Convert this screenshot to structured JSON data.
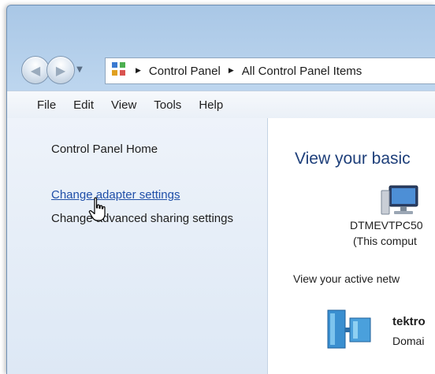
{
  "navigation": {
    "breadcrumb": [
      "Control Panel",
      "All Control Panel Items"
    ]
  },
  "menubar": {
    "items": [
      "File",
      "Edit",
      "View",
      "Tools",
      "Help"
    ]
  },
  "left_pane": {
    "home_label": "Control Panel Home",
    "adapter_link": "Change adapter settings",
    "sharing_link": "Change advanced sharing settings"
  },
  "right_pane": {
    "heading": "View your basic",
    "computer_name": "DTMEVTPC50",
    "computer_note": "(This comput",
    "active_networks": "View your active netw",
    "network_name": "tektro",
    "network_type": "Domai"
  },
  "colors": {
    "link": "#1f4fa8",
    "heading": "#1e3f7a",
    "pane_bg": "#eef3fa"
  }
}
